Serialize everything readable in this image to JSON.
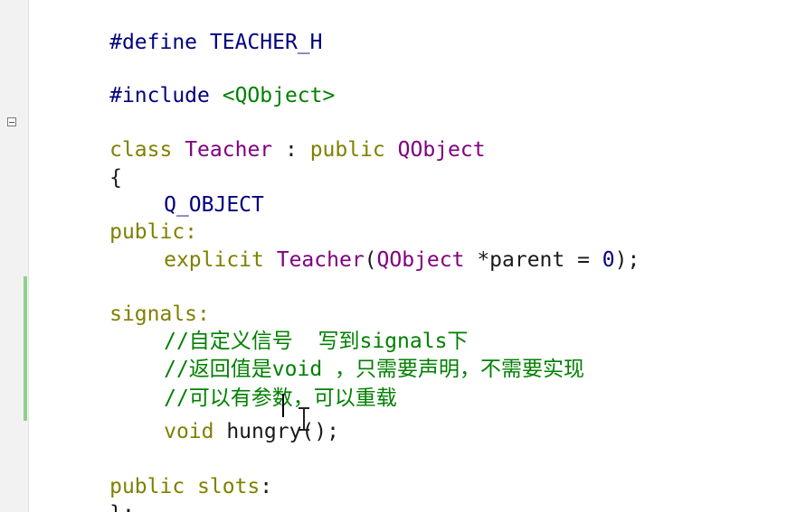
{
  "editor": {
    "lines": {
      "l1": {
        "a": "#define TEACHER_H"
      },
      "l2": {
        "a": "#include ",
        "b": "<QObject>"
      },
      "l3": {
        "a": "class",
        "b": " ",
        "c": "Teacher",
        "d": " : ",
        "e": "public",
        "f": " ",
        "g": "QObject"
      },
      "l4": {
        "a": "{"
      },
      "l5": {
        "a": "Q_OBJECT"
      },
      "l6": {
        "a": "public:"
      },
      "l7": {
        "a": "explicit",
        "b": " ",
        "c": "Teacher",
        "d": "(",
        "e": "QObject",
        "f": " *parent = ",
        "g": "0",
        "h": ");"
      },
      "l8": {
        "a": "signals:"
      },
      "l9": {
        "a": "//自定义信号  写到signals下"
      },
      "l10": {
        "a": "//返回值是void ，只需要声明，不需要实现"
      },
      "l11": {
        "a": "//可以有参数，可以重载"
      },
      "l12": {
        "a": "void",
        "b": " hungry();"
      },
      "l13": {
        "a": "public",
        "b": " ",
        "c": "slots",
        "d": ":"
      },
      "l14": {
        "a": "};"
      }
    },
    "colors": {
      "keyword": "#808000",
      "type": "#800080",
      "string": "#008000",
      "comment": "#008000",
      "number": "#000080",
      "macro": "#000080",
      "change_bar": "#8fd08f"
    },
    "icons": [
      "fold-collapse-icon",
      "text-cursor-icon"
    ]
  }
}
